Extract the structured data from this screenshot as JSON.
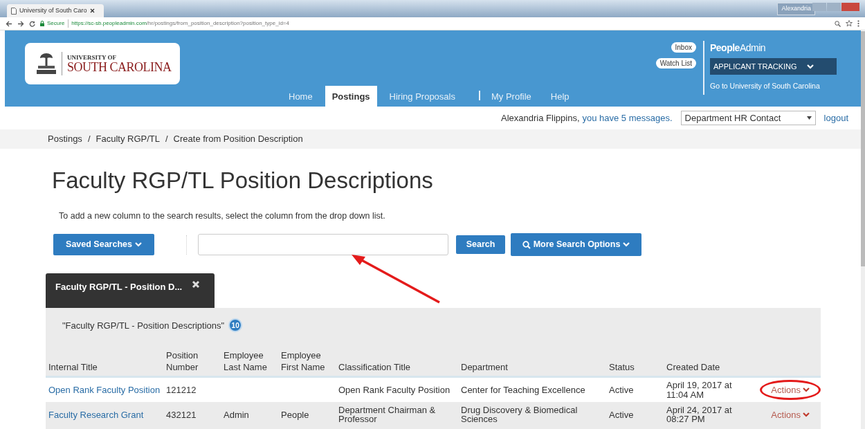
{
  "browser": {
    "tab_title": "University of South Caro",
    "user_badge": "Alexandria",
    "secure_label": "Secure",
    "url_host": "https://sc-sb.peopleadmin.com",
    "url_path": "/hr/postings/from_position_description?position_type_id=4"
  },
  "header": {
    "logo": {
      "line1": "UNIVERSITY OF",
      "line2": "SOUTH CAROLINA"
    },
    "nav": [
      {
        "label": "Home",
        "selected": false,
        "divider_before": false
      },
      {
        "label": "Postings",
        "selected": true,
        "divider_before": false
      },
      {
        "label": "Hiring Proposals",
        "selected": false,
        "divider_before": false
      },
      {
        "label": "My Profile",
        "selected": false,
        "divider_before": true
      },
      {
        "label": "Help",
        "selected": false,
        "divider_before": false
      }
    ],
    "quick_links": [
      "Inbox",
      "Watch List"
    ],
    "brand": "**People**Admin",
    "product": "APPLICANT TRACKING",
    "go_link": "Go to University of South Carolina"
  },
  "user_bar": {
    "name": "Alexandria Flippins,",
    "messages": "you have 5 messages.",
    "role_select": "Department HR Contact",
    "logout": "logout"
  },
  "breadcrumbs": {
    "separator": "/",
    "items": [
      "Postings",
      "Faculty RGP/TL",
      "Create from Position Description"
    ]
  },
  "page_title": "Faculty RGP/TL Position Descriptions",
  "hint": "To add a new column to the search results, select the column from the drop down list.",
  "search": {
    "saved_searches": "Saved Searches",
    "search_button": "Search",
    "more_options": "More Search Options"
  },
  "result_tab": {
    "label": "Faculty RGP/TL - Position D..."
  },
  "results": {
    "caption": "\"Faculty RGP/TL - Position Descriptions\"",
    "count": "10",
    "columns": [
      "Internal Title",
      "Position Number",
      "Employee Last Name",
      "Employee First Name",
      "Classification Title",
      "Department",
      "Status",
      "Created Date"
    ],
    "rows": [
      {
        "cells": [
          "Open Rank Faculty Position",
          "121212",
          "",
          "",
          "Open Rank Faculty Position",
          "Center for Teaching Excellence",
          "Active",
          "April 19, 2017 at 11:04 AM"
        ],
        "action": "Actions",
        "circled": true
      },
      {
        "cells": [
          "Faculty Research Grant",
          "432121",
          "Admin",
          "People",
          "Department Chairman & Professor",
          "Drug Discovery & Biomedical Sciences",
          "Active",
          "April 24, 2017 at 08:27 PM"
        ],
        "action": "Actions",
        "circled": false
      }
    ]
  }
}
